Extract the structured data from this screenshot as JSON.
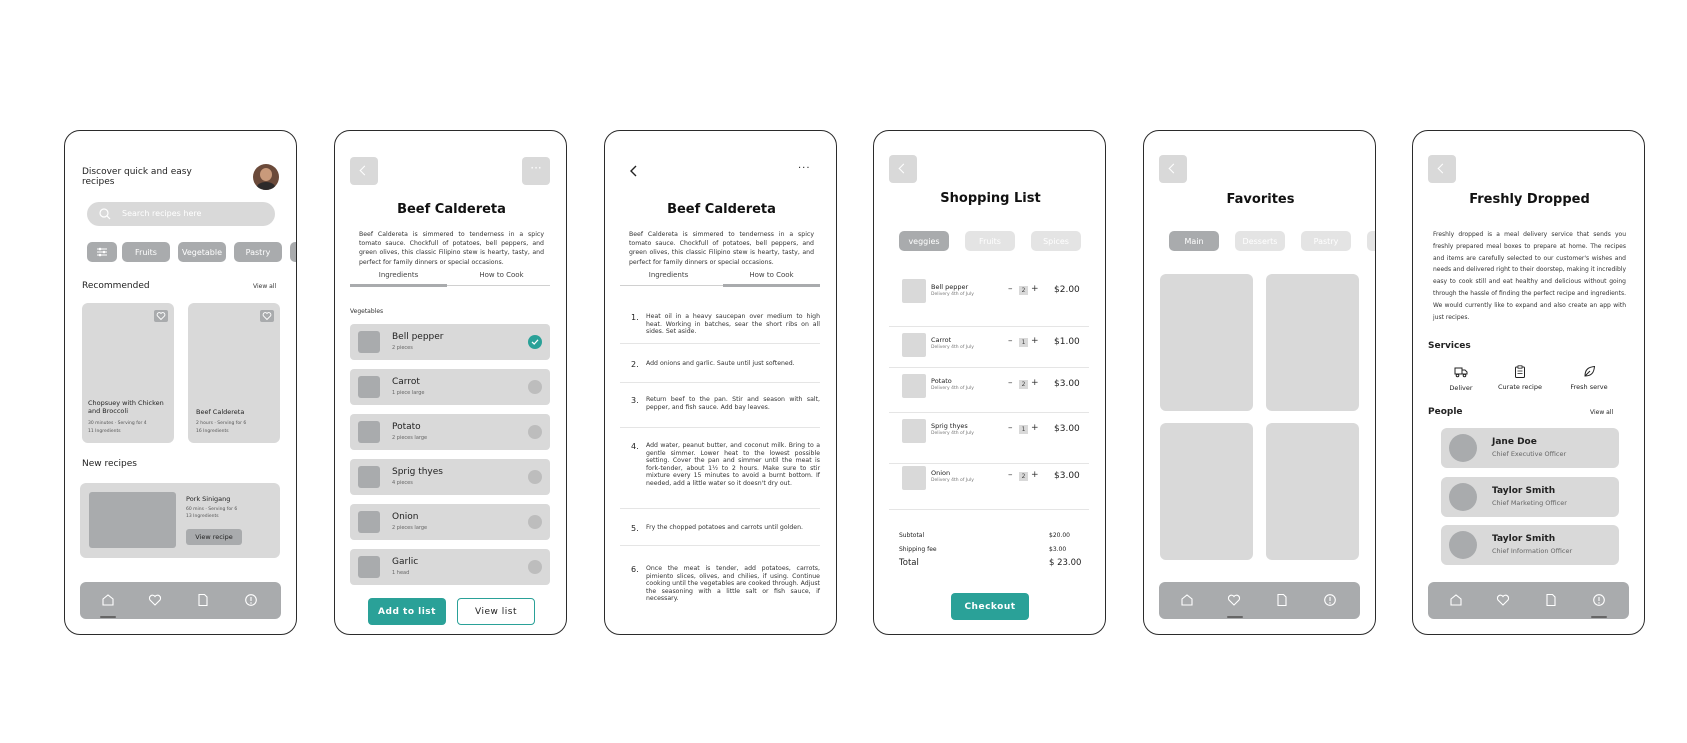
{
  "s1": {
    "heading": "Discover quick and easy recipes",
    "search_placeholder": "Search recipes here",
    "chips": [
      "Fruits",
      "Vegetable",
      "Pastry"
    ],
    "recommended": "Recommended",
    "view_all": "View all",
    "cards": [
      {
        "title": "Chopsuey with Chicken and Broccoli",
        "meta": "30 minutes · Serving for 4",
        "ingredients": "11 Ingredients"
      },
      {
        "title": "Beef Caldereta",
        "meta": "2 hours · Serving for 6",
        "ingredients": "16 Ingredients"
      }
    ],
    "new_recipes": "New recipes",
    "new_recipe": {
      "title": "Pork Sinigang",
      "meta": "60 mins · Serving for 6",
      "ingredients": "13 Ingredients",
      "button": "View recipe"
    }
  },
  "s2": {
    "title": "Beef Caldereta",
    "desc": "Beef Caldereta is simmered to tenderness in a spicy tomato sauce. Chockfull of potatoes, bell peppers, and green olives, this classic Filipino stew is hearty, tasty, and perfect for family dinners or special occasions.",
    "tab_ingredients": "Ingredients",
    "tab_howto": "How to Cook",
    "section": "Vegetables",
    "items": [
      {
        "name": "Bell pepper",
        "qty": "2 pieces"
      },
      {
        "name": "Carrot",
        "qty": "1 piece large"
      },
      {
        "name": "Potato",
        "qty": "2 pieces large"
      },
      {
        "name": "Sprig thyes",
        "qty": "4 pieces"
      },
      {
        "name": "Onion",
        "qty": "2 pieces large"
      },
      {
        "name": "Garlic",
        "qty": "1 head"
      }
    ],
    "add_button": "Add to list",
    "view_button": "View list"
  },
  "s3": {
    "title": "Beef Caldereta",
    "desc": "Beef Caldereta is simmered to tenderness in a spicy tomato sauce. Chockfull of potatoes, bell peppers, and green olives, this classic Filipino stew is hearty, tasty, and perfect for family dinners or special occasions.",
    "tab_ingredients": "Ingredients",
    "tab_howto": "How to Cook",
    "steps": [
      {
        "n": "1.",
        "text": "Heat oil in a heavy saucepan over medium to high heat. Working in batches, sear the short ribs on all sides. Set aside."
      },
      {
        "n": "2.",
        "text": "Add onions and garlic. Saute until just softened."
      },
      {
        "n": "3.",
        "text": "Return beef to the pan. Stir and season with salt, pepper, and fish sauce. Add bay leaves."
      },
      {
        "n": "4.",
        "text": "Add water, peanut butter, and coconut milk. Bring to a gentle simmer. Lower heat to the lowest possible setting. Cover the pan and simmer until the meat is fork-tender, about 1½ to 2 hours. Make sure to stir mixture every 15 minutes to avoid a burnt bottom. If needed, add a little water so it doesn't dry out."
      },
      {
        "n": "5.",
        "text": "Fry the chopped potatoes and carrots until golden."
      },
      {
        "n": "6.",
        "text": "Once the meat is tender, add potatoes, carrots, pimiento slices, olives, and chilies, if using. Continue cooking until the vegetables are cooked through. Adjust the seasoning with a little salt or fish sauce, if necessary."
      }
    ]
  },
  "s4": {
    "title": "Shopping List",
    "chips": [
      "veggies",
      "Fruits",
      "Spices"
    ],
    "rows": [
      {
        "name": "Bell pepper",
        "date": "Delivery 4th of July",
        "qty": "2",
        "price": "$2.00"
      },
      {
        "name": "Carrot",
        "date": "Delivery 4th of July",
        "qty": "1",
        "price": "$1.00"
      },
      {
        "name": "Potato",
        "date": "Delivery 4th of July",
        "qty": "2",
        "price": "$3.00"
      },
      {
        "name": "Sprig thyes",
        "date": "Delivery 4th of July",
        "qty": "1",
        "price": "$3.00"
      },
      {
        "name": "Onion",
        "date": "Delivery 4th of July",
        "qty": "2",
        "price": "$3.00"
      }
    ],
    "subtotal_label": "Subtotal",
    "subtotal": "$20.00",
    "shipping_label": "Shipping fee",
    "shipping": "$3.00",
    "total_label": "Total",
    "total": "$ 23.00",
    "checkout": "Checkout"
  },
  "s5": {
    "title": "Favorites",
    "chips": [
      "Main",
      "Desserts",
      "Pastry"
    ]
  },
  "s6": {
    "title": "Freshly Dropped",
    "desc": "Freshly dropped is a meal delivery service that sends you freshly prepared meal boxes to prepare at home. The recipes and items are carefully selected to our customer's wishes and needs and delivered right to their doorstep, making it incredibly easy to cook still and eat healthy and delicious without going through the hassle of finding the perfect recipe and ingredients. We would currently like to expand and also create an app with just recipes.",
    "services_label": "Services",
    "services": [
      "Deliver",
      "Curate recipe",
      "Fresh serve"
    ],
    "people_label": "People",
    "view_all": "View all",
    "people": [
      {
        "name": "Jane Doe",
        "role": "Chief Executive Officer"
      },
      {
        "name": "Taylor Smith",
        "role": "Chief Marketing Officer"
      },
      {
        "name": "Taylor Smith",
        "role": "Chief Information Officer"
      }
    ]
  },
  "colors": {
    "accent": "#2aa198",
    "placeholder": "#d9d9d9",
    "dark_placeholder": "#a9abad"
  },
  "icons": [
    "home-icon",
    "heart-icon",
    "document-icon",
    "info-icon",
    "filter-icon",
    "search-icon",
    "check-icon",
    "truck-icon",
    "clipboard-icon",
    "leaf-icon",
    "chevron-left-icon",
    "more-icon"
  ]
}
